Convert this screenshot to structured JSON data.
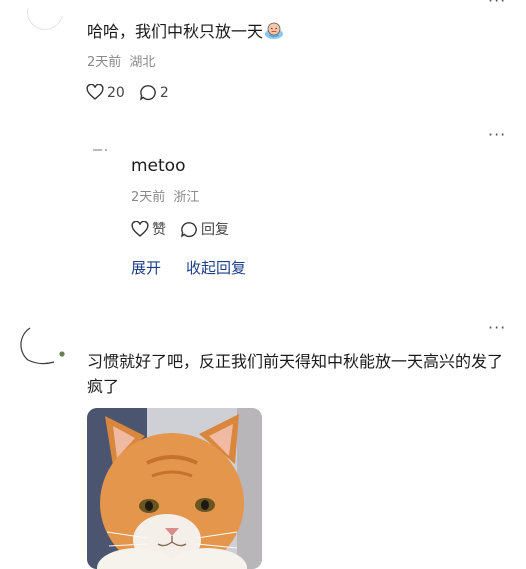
{
  "comment1": {
    "text": "哈哈，我们中秋只放一天",
    "emoji_icon": "crying-face-emoji-icon",
    "time": "2天前",
    "location": "湖北",
    "likes": "20",
    "replies": "2"
  },
  "reply1": {
    "username": "metoo",
    "time": "2天前",
    "location": "浙江",
    "like_label": "赞",
    "reply_label": "回复",
    "expand_label": "展开",
    "collapse_label": "收起回复"
  },
  "comment2": {
    "text": "习惯就好了吧，反正我们前天得知中秋能放一天高兴的发了疯了",
    "image_icon": "orange-cat-photo"
  },
  "more_label": "···"
}
